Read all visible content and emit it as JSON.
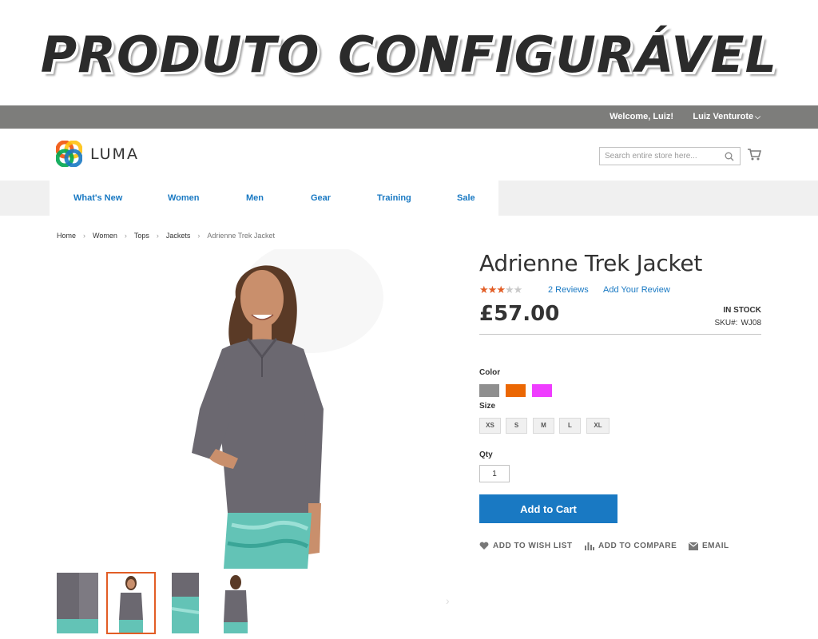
{
  "banner": {
    "title": "PRODUTO CONFIGURÁVEL"
  },
  "panel": {
    "welcome": "Welcome, Luiz!",
    "user_name": "Luiz Venturote",
    "chevron": "⌵"
  },
  "header": {
    "logo_text": "LUMA",
    "logo_colors": [
      "#f26322",
      "#ffc20e",
      "#00a651",
      "#1979c3"
    ],
    "search_placeholder": "Search entire store here...",
    "search_icon": "search-icon",
    "cart_icon": "cart-icon"
  },
  "nav": {
    "items": [
      {
        "label": "What's New"
      },
      {
        "label": "Women"
      },
      {
        "label": "Men"
      },
      {
        "label": "Gear"
      },
      {
        "label": "Training"
      },
      {
        "label": "Sale"
      }
    ]
  },
  "breadcrumb": {
    "separator": "›",
    "items": [
      "Home",
      "Women",
      "Tops",
      "Jackets",
      "Adrienne Trek Jacket"
    ]
  },
  "product": {
    "title": "Adrienne Trek Jacket",
    "rating": {
      "value": 3,
      "max": 5
    },
    "reviews_link": "2 Reviews",
    "add_review_link": "Add Your Review",
    "price": "£57.00",
    "stock": "IN STOCK",
    "sku_label": "SKU#:",
    "sku_value": "WJ08",
    "color_label": "Color",
    "colors": [
      "#8f8f8f",
      "#eb6703",
      "#ef3dff"
    ],
    "size_label": "Size",
    "sizes": [
      "XS",
      "S",
      "M",
      "L",
      "XL"
    ],
    "qty_label": "Qty",
    "qty_value": "1",
    "add_to_cart": "Add to Cart",
    "wishlist": "ADD TO WISH LIST",
    "compare": "ADD TO COMPARE",
    "email": "EMAIL"
  },
  "gallery": {
    "active_thumb": 2,
    "thumbs": 4,
    "next_arrow": "›"
  },
  "colors": {
    "accent": "#1979c3",
    "star_on": "#e25d25",
    "panel": "#7d7d7b",
    "nav_bg": "#f0f0f0"
  }
}
